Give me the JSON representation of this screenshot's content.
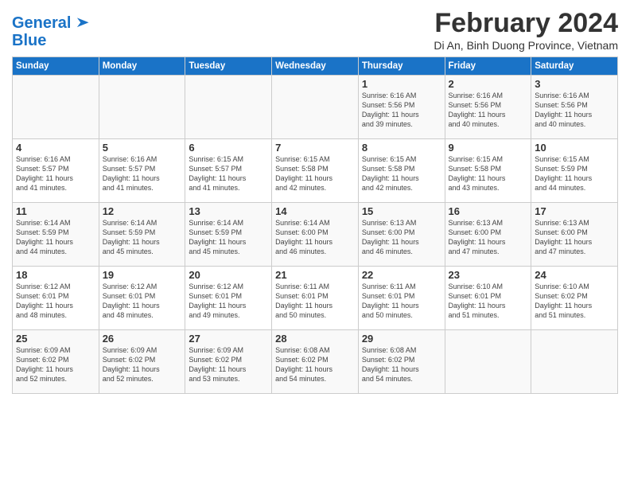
{
  "header": {
    "logo_line1": "General",
    "logo_line2": "Blue",
    "month": "February 2024",
    "location": "Di An, Binh Duong Province, Vietnam"
  },
  "weekdays": [
    "Sunday",
    "Monday",
    "Tuesday",
    "Wednesday",
    "Thursday",
    "Friday",
    "Saturday"
  ],
  "weeks": [
    [
      {
        "day": "",
        "detail": ""
      },
      {
        "day": "",
        "detail": ""
      },
      {
        "day": "",
        "detail": ""
      },
      {
        "day": "",
        "detail": ""
      },
      {
        "day": "1",
        "detail": "Sunrise: 6:16 AM\nSunset: 5:56 PM\nDaylight: 11 hours\nand 39 minutes."
      },
      {
        "day": "2",
        "detail": "Sunrise: 6:16 AM\nSunset: 5:56 PM\nDaylight: 11 hours\nand 40 minutes."
      },
      {
        "day": "3",
        "detail": "Sunrise: 6:16 AM\nSunset: 5:56 PM\nDaylight: 11 hours\nand 40 minutes."
      }
    ],
    [
      {
        "day": "4",
        "detail": "Sunrise: 6:16 AM\nSunset: 5:57 PM\nDaylight: 11 hours\nand 41 minutes."
      },
      {
        "day": "5",
        "detail": "Sunrise: 6:16 AM\nSunset: 5:57 PM\nDaylight: 11 hours\nand 41 minutes."
      },
      {
        "day": "6",
        "detail": "Sunrise: 6:15 AM\nSunset: 5:57 PM\nDaylight: 11 hours\nand 41 minutes."
      },
      {
        "day": "7",
        "detail": "Sunrise: 6:15 AM\nSunset: 5:58 PM\nDaylight: 11 hours\nand 42 minutes."
      },
      {
        "day": "8",
        "detail": "Sunrise: 6:15 AM\nSunset: 5:58 PM\nDaylight: 11 hours\nand 42 minutes."
      },
      {
        "day": "9",
        "detail": "Sunrise: 6:15 AM\nSunset: 5:58 PM\nDaylight: 11 hours\nand 43 minutes."
      },
      {
        "day": "10",
        "detail": "Sunrise: 6:15 AM\nSunset: 5:59 PM\nDaylight: 11 hours\nand 44 minutes."
      }
    ],
    [
      {
        "day": "11",
        "detail": "Sunrise: 6:14 AM\nSunset: 5:59 PM\nDaylight: 11 hours\nand 44 minutes."
      },
      {
        "day": "12",
        "detail": "Sunrise: 6:14 AM\nSunset: 5:59 PM\nDaylight: 11 hours\nand 45 minutes."
      },
      {
        "day": "13",
        "detail": "Sunrise: 6:14 AM\nSunset: 5:59 PM\nDaylight: 11 hours\nand 45 minutes."
      },
      {
        "day": "14",
        "detail": "Sunrise: 6:14 AM\nSunset: 6:00 PM\nDaylight: 11 hours\nand 46 minutes."
      },
      {
        "day": "15",
        "detail": "Sunrise: 6:13 AM\nSunset: 6:00 PM\nDaylight: 11 hours\nand 46 minutes."
      },
      {
        "day": "16",
        "detail": "Sunrise: 6:13 AM\nSunset: 6:00 PM\nDaylight: 11 hours\nand 47 minutes."
      },
      {
        "day": "17",
        "detail": "Sunrise: 6:13 AM\nSunset: 6:00 PM\nDaylight: 11 hours\nand 47 minutes."
      }
    ],
    [
      {
        "day": "18",
        "detail": "Sunrise: 6:12 AM\nSunset: 6:01 PM\nDaylight: 11 hours\nand 48 minutes."
      },
      {
        "day": "19",
        "detail": "Sunrise: 6:12 AM\nSunset: 6:01 PM\nDaylight: 11 hours\nand 48 minutes."
      },
      {
        "day": "20",
        "detail": "Sunrise: 6:12 AM\nSunset: 6:01 PM\nDaylight: 11 hours\nand 49 minutes."
      },
      {
        "day": "21",
        "detail": "Sunrise: 6:11 AM\nSunset: 6:01 PM\nDaylight: 11 hours\nand 50 minutes."
      },
      {
        "day": "22",
        "detail": "Sunrise: 6:11 AM\nSunset: 6:01 PM\nDaylight: 11 hours\nand 50 minutes."
      },
      {
        "day": "23",
        "detail": "Sunrise: 6:10 AM\nSunset: 6:01 PM\nDaylight: 11 hours\nand 51 minutes."
      },
      {
        "day": "24",
        "detail": "Sunrise: 6:10 AM\nSunset: 6:02 PM\nDaylight: 11 hours\nand 51 minutes."
      }
    ],
    [
      {
        "day": "25",
        "detail": "Sunrise: 6:09 AM\nSunset: 6:02 PM\nDaylight: 11 hours\nand 52 minutes."
      },
      {
        "day": "26",
        "detail": "Sunrise: 6:09 AM\nSunset: 6:02 PM\nDaylight: 11 hours\nand 52 minutes."
      },
      {
        "day": "27",
        "detail": "Sunrise: 6:09 AM\nSunset: 6:02 PM\nDaylight: 11 hours\nand 53 minutes."
      },
      {
        "day": "28",
        "detail": "Sunrise: 6:08 AM\nSunset: 6:02 PM\nDaylight: 11 hours\nand 54 minutes."
      },
      {
        "day": "29",
        "detail": "Sunrise: 6:08 AM\nSunset: 6:02 PM\nDaylight: 11 hours\nand 54 minutes."
      },
      {
        "day": "",
        "detail": ""
      },
      {
        "day": "",
        "detail": ""
      }
    ]
  ]
}
